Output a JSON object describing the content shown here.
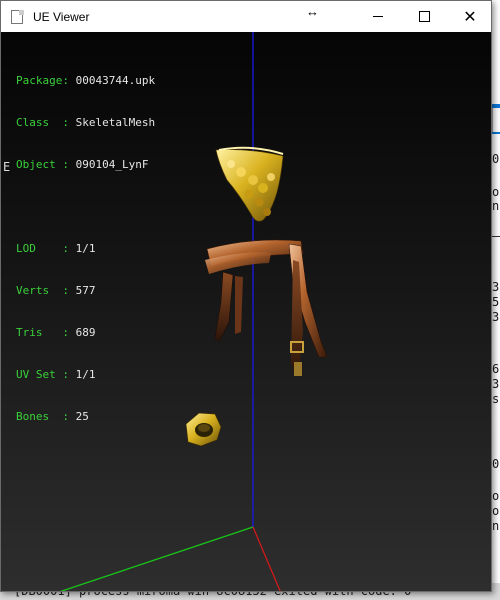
{
  "window": {
    "title": "UE Viewer",
    "resize_cursor": "↔",
    "controls": {
      "minimize": "minimize-icon",
      "maximize": "maximize-icon",
      "close": "close-icon"
    }
  },
  "info": {
    "package_label": "Package:",
    "package": "00043744.upk",
    "class_label": "Class  :",
    "class": "SkeletalMesh",
    "object_label": "Object :",
    "object": "090104_LynF",
    "lod_label": "LOD    :",
    "lod": "1/1",
    "verts_label": "Verts  :",
    "verts": "577",
    "tris_label": "Tris   :",
    "tris": "689",
    "uvset_label": "UV Set :",
    "uvset": "1/1",
    "bones_label": "Bones  :",
    "bones": "25"
  },
  "background_console": {
    "lines": [
      {
        "text": "0"
      },
      {
        "text": "o"
      },
      {
        "text": "n"
      },
      {
        "text": "3"
      },
      {
        "text": "5"
      },
      {
        "text": "3"
      },
      {
        "text": "6"
      },
      {
        "text": "3"
      },
      {
        "text": "s"
      },
      {
        "text": "0"
      },
      {
        "text": "o"
      },
      {
        "text": "o"
      },
      {
        "text": "n"
      }
    ],
    "left_fragment": "E",
    "bottom_line": "[DB0001] process  miroma win 8c08132  exited with code: 0"
  },
  "colors": {
    "label_green": "#3ad13a",
    "value_white": "#e6e6e6",
    "axis_blue": "#1a1ae6",
    "axis_green": "#19c419",
    "axis_red": "#d21a1a",
    "gold": "#d9b21f",
    "copper": "#b5652e"
  }
}
